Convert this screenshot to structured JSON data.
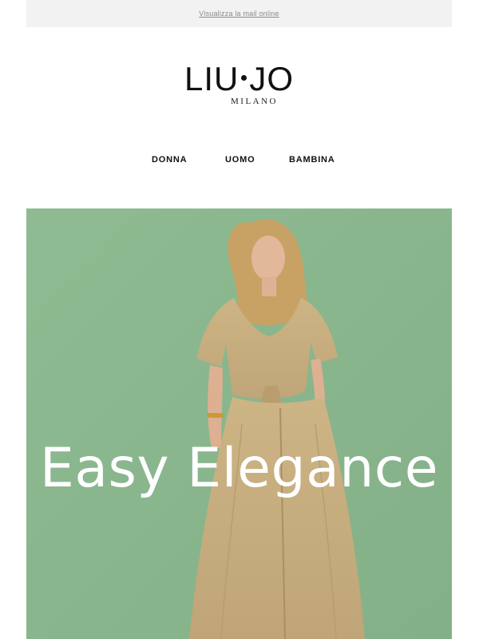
{
  "preheader": {
    "view_online": "Visualizza la mail online"
  },
  "header": {
    "brand": [
      "LIU",
      "JO"
    ],
    "subbrand": "MILANO"
  },
  "nav": {
    "items": [
      {
        "label": "DONNA"
      },
      {
        "label": "UOMO"
      },
      {
        "label": "BAMBINA"
      }
    ]
  },
  "hero": {
    "headline": "Easy Elegance",
    "background_color": "#8ab68e",
    "outfit_color": "#c8ae80"
  }
}
